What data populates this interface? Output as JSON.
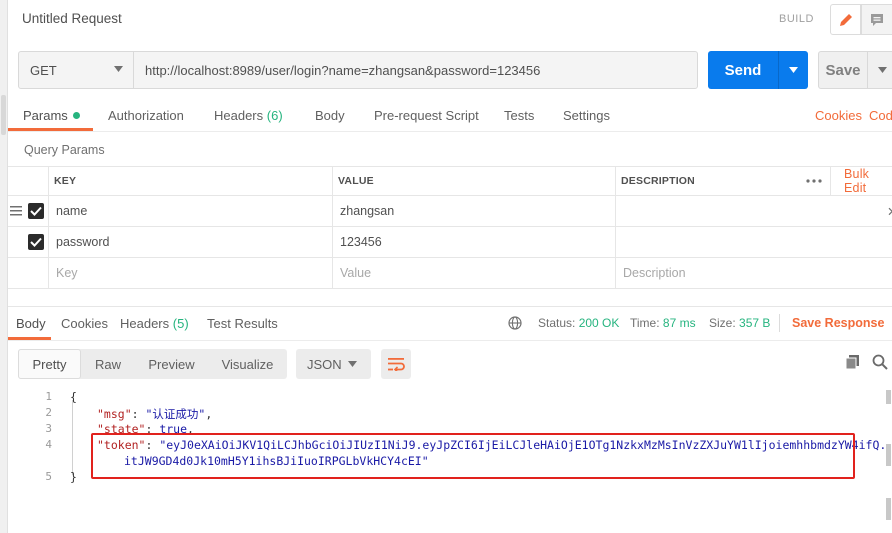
{
  "header": {
    "title": "Untitled Request",
    "build_label": "BUILD"
  },
  "request": {
    "method": "GET",
    "url": "http://localhost:8989/user/login?name=zhangsan&password=123456",
    "send_label": "Send",
    "save_label": "Save"
  },
  "request_tabs": {
    "params": "Params",
    "authorization": "Authorization",
    "headers": "Headers",
    "headers_count": "(6)",
    "body": "Body",
    "prerequest": "Pre-request Script",
    "tests": "Tests",
    "settings": "Settings",
    "cookies": "Cookies",
    "code": "Code"
  },
  "query_params": {
    "label": "Query Params",
    "columns": {
      "key": "KEY",
      "value": "VALUE",
      "description": "DESCRIPTION"
    },
    "bulk_edit": "Bulk Edit",
    "rows": [
      {
        "key": "name",
        "value": "zhangsan",
        "description": ""
      },
      {
        "key": "password",
        "value": "123456",
        "description": ""
      }
    ],
    "placeholders": {
      "key": "Key",
      "value": "Value",
      "description": "Description"
    }
  },
  "response_tabs": {
    "body": "Body",
    "cookies": "Cookies",
    "headers": "Headers",
    "headers_count": "(5)",
    "test_results": "Test Results"
  },
  "response_status": {
    "status_label": "Status:",
    "status_value": "200 OK",
    "time_label": "Time:",
    "time_value": "87 ms",
    "size_label": "Size:",
    "size_value": "357 B",
    "save_response": "Save Response"
  },
  "view_modes": {
    "pretty": "Pretty",
    "raw": "Raw",
    "preview": "Preview",
    "visualize": "Visualize",
    "format": "JSON"
  },
  "response_body": {
    "line_numbers": [
      "1",
      "2",
      "3",
      "4",
      "",
      "5"
    ],
    "open_brace": "{",
    "close_brace": "}",
    "msg_key": "\"msg\"",
    "msg_value": "\"认证成功\"",
    "state_key": "\"state\"",
    "state_value": "true",
    "token_key": "\"token\"",
    "token_value_line1": "\"eyJ0eXAiOiJKV1QiLCJhbGciOiJIUzI1NiJ9.eyJpZCI6IjEiLCJleHAiOjE1OTg1NzkxMzMsInVzZXJuYW1lIjoiemhhbmdzYW4ifQ.",
    "token_value_line2": "itJW9GD4d0Jk10mH5Y1ihsBJiIuoIRPGLbVkHCY4cEI\""
  },
  "colors": {
    "accent": "#f26b3a",
    "send_blue": "#097bed",
    "success_green": "#26b47f",
    "highlight_red": "#e1221d"
  }
}
